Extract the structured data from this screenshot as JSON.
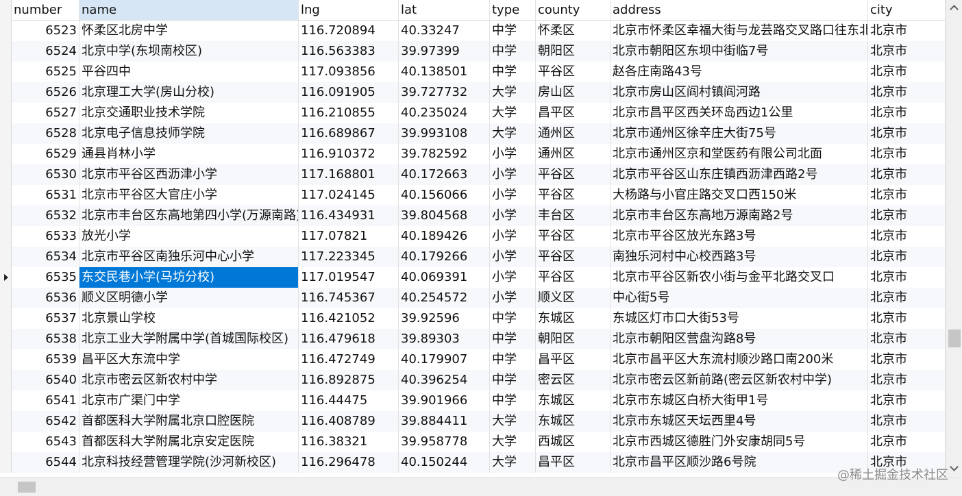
{
  "columns": [
    "number",
    "name",
    "lng",
    "lat",
    "type",
    "county",
    "address",
    "city"
  ],
  "sorted_column": "name",
  "selected_row_index": 12,
  "selected_column": "name",
  "rows": [
    [
      "6523",
      "怀柔区北房中学",
      "116.720894",
      "40.33247",
      "中学",
      "怀柔区",
      "北京市怀柔区幸福大街与龙芸路交叉路口往东北",
      "北京市"
    ],
    [
      "6524",
      "北京中学(东坝南校区)",
      "116.563383",
      "39.97399",
      "中学",
      "朝阳区",
      "北京市朝阳区东坝中街临7号",
      "北京市"
    ],
    [
      "6525",
      "平谷四中",
      "117.093856",
      "40.138501",
      "中学",
      "平谷区",
      "赵各庄南路43号",
      "北京市"
    ],
    [
      "6526",
      "北京理工大学(房山分校)",
      "116.091905",
      "39.727732",
      "大学",
      "房山区",
      "北京市房山区阎村镇阎河路",
      "北京市"
    ],
    [
      "6527",
      "北京交通职业技术学院",
      "116.210855",
      "40.235024",
      "大学",
      "昌平区",
      "北京市昌平区西关环岛西边1公里",
      "北京市"
    ],
    [
      "6528",
      "北京电子信息技师学院",
      "116.689867",
      "39.993108",
      "大学",
      "通州区",
      "北京市通州区徐辛庄大街75号",
      "北京市"
    ],
    [
      "6529",
      "通县肖林小学",
      "116.910372",
      "39.782592",
      "小学",
      "通州区",
      "北京市通州区京和堂医药有限公司北面",
      "北京市"
    ],
    [
      "6530",
      "北京市平谷区西沥津小学",
      "117.168801",
      "40.172663",
      "小学",
      "平谷区",
      "北京市平谷区山东庄镇西沥津西路2号",
      "北京市"
    ],
    [
      "6531",
      "北京市平谷区大官庄小学",
      "117.024145",
      "40.156066",
      "小学",
      "平谷区",
      "大杨路与小官庄路交叉口西150米",
      "北京市"
    ],
    [
      "6532",
      "北京市丰台区东高地第四小学(万源南路)",
      "116.434931",
      "39.804568",
      "小学",
      "丰台区",
      "北京市丰台区东高地万源南路2号",
      "北京市"
    ],
    [
      "6533",
      "放光小学",
      "117.07821",
      "40.189426",
      "小学",
      "平谷区",
      "北京市平谷区放光东路3号",
      "北京市"
    ],
    [
      "6534",
      "北京市平谷区南独乐河中心小学",
      "117.223345",
      "40.179266",
      "小学",
      "平谷区",
      "南独乐河村中心校西路3号",
      "北京市"
    ],
    [
      "6535",
      "东交民巷小学(马坊分校)",
      "117.019547",
      "40.069391",
      "小学",
      "平谷区",
      "北京市平谷区新农小街与金平北路交叉口",
      "北京市"
    ],
    [
      "6536",
      "顺义区明德小学",
      "116.745367",
      "40.254572",
      "小学",
      "顺义区",
      "中心街5号",
      "北京市"
    ],
    [
      "6537",
      "北京景山学校",
      "116.421052",
      "39.92596",
      "中学",
      "东城区",
      "东城区灯市口大街53号",
      "北京市"
    ],
    [
      "6538",
      "北京工业大学附属中学(首城国际校区)",
      "116.479618",
      "39.89303",
      "中学",
      "朝阳区",
      "北京市朝阳区营盘沟路8号",
      "北京市"
    ],
    [
      "6539",
      "昌平区大东流中学",
      "116.472749",
      "40.179907",
      "中学",
      "昌平区",
      "北京市昌平区大东流村顺沙路口南200米",
      "北京市"
    ],
    [
      "6540",
      "北京市密云区新农村中学",
      "116.892875",
      "40.396254",
      "中学",
      "密云区",
      "北京市密云区新前路(密云区新农村中学)",
      "北京市"
    ],
    [
      "6541",
      "北京市广渠门中学",
      "116.44475",
      "39.901966",
      "中学",
      "东城区",
      "北京市东城区白桥大街甲1号",
      "北京市"
    ],
    [
      "6542",
      "首都医科大学附属北京口腔医院",
      "116.408789",
      "39.884411",
      "大学",
      "东城区",
      "北京市东城区天坛西里4号",
      "北京市"
    ],
    [
      "6543",
      "首都医科大学附属北京安定医院",
      "116.38321",
      "39.958778",
      "大学",
      "西城区",
      "北京市西城区德胜门外安康胡同5号",
      "北京市"
    ],
    [
      "6544",
      "北京科技经营管理学院(沙河新校区)",
      "116.296478",
      "40.150244",
      "大学",
      "昌平区",
      "北京市昌平区顺沙路6号院",
      "北京市"
    ]
  ],
  "watermark": "@稀土掘金技术社区",
  "colors": {
    "selection": "#0078d7",
    "header_sorted": "#d6e6f5",
    "alt_row": "#f6f8fb"
  }
}
